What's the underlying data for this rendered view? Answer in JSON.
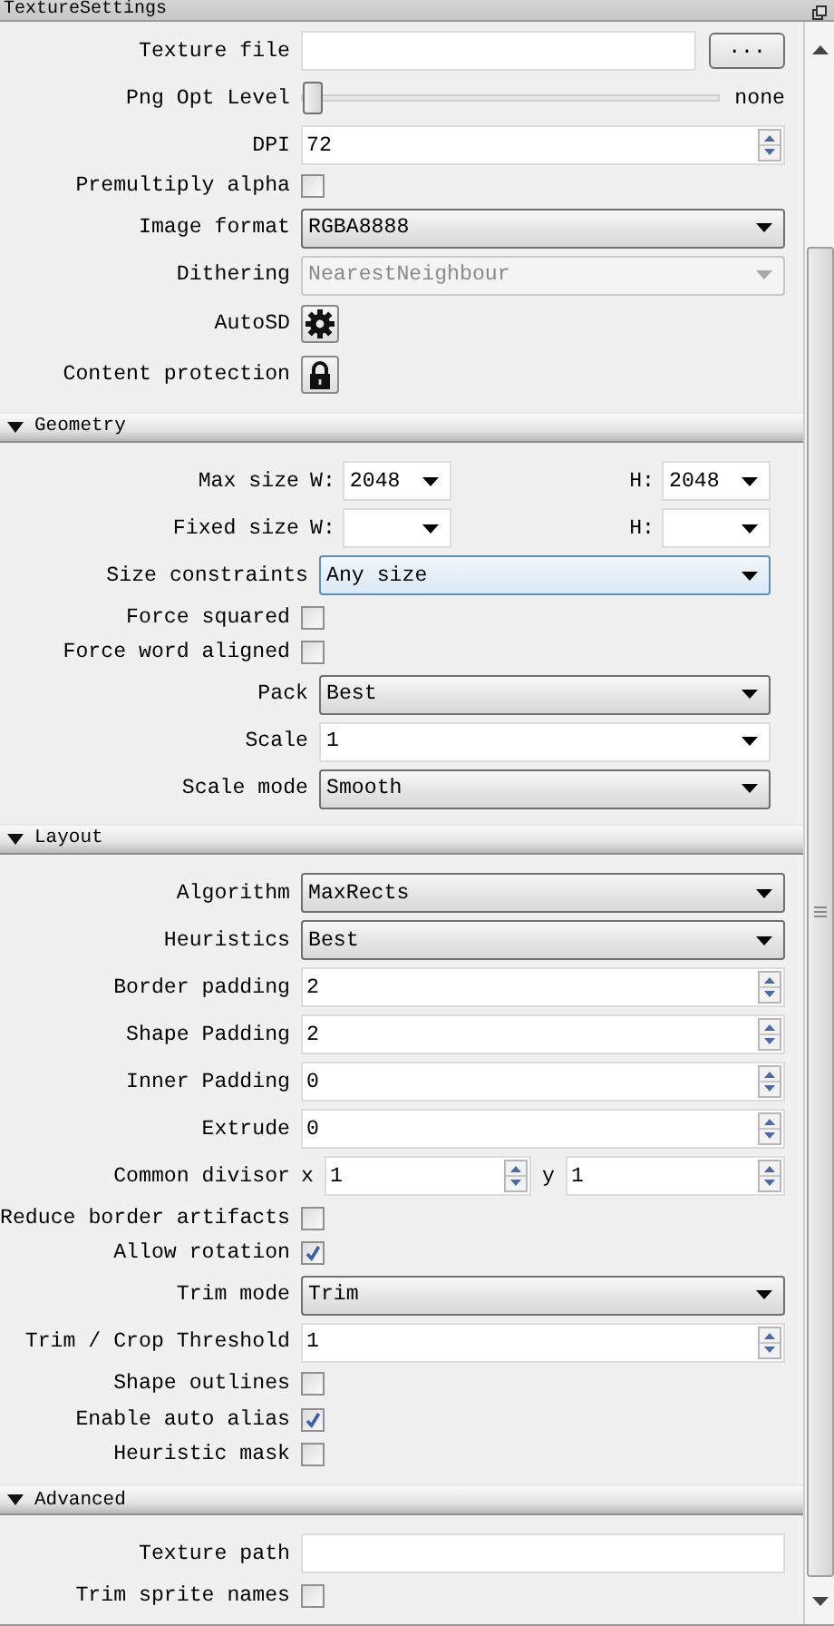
{
  "window": {
    "title": "TextureSettings"
  },
  "sections": [
    {
      "rows": [
        {
          "kind": "file",
          "label": "Texture file",
          "button": "..."
        },
        {
          "kind": "slider",
          "label": "Png Opt Level",
          "level": 0,
          "reading": "none"
        },
        {
          "kind": "spin",
          "label": "DPI",
          "value": "72"
        },
        {
          "kind": "check",
          "label": "Premultiply alpha",
          "checked": false
        },
        {
          "kind": "combo",
          "label": "Image format",
          "value": "RGBA8888",
          "editable": false,
          "disabled": false,
          "focused": false
        },
        {
          "kind": "combo",
          "label": "Dithering",
          "value": "NearestNeighbour",
          "editable": false,
          "disabled": true,
          "focused": false
        },
        {
          "kind": "gear",
          "label": "AutoSD"
        },
        {
          "kind": "lock",
          "label": "Content protection"
        }
      ]
    },
    {
      "title": "Geometry",
      "expanded": true,
      "rows": [
        {
          "kind": "size",
          "label": "Max size",
          "w_label": "W:",
          "w_value": "2048",
          "h_label": "H:",
          "h_value": "2048"
        },
        {
          "kind": "size",
          "label": "Fixed size",
          "w_label": "W:",
          "h_label": "H:"
        },
        {
          "kind": "combo",
          "label": "Size constraints",
          "value": "Any size",
          "editable": false,
          "disabled": false,
          "focused": true
        },
        {
          "kind": "check",
          "label": "Force squared",
          "checked": false
        },
        {
          "kind": "check",
          "label": "Force word aligned",
          "checked": false
        },
        {
          "kind": "combo",
          "label": "Pack",
          "value": "Best",
          "editable": false,
          "disabled": false,
          "focused": false
        },
        {
          "kind": "combo",
          "label": "Scale",
          "value": "1",
          "editable": true,
          "disabled": false,
          "focused": false
        },
        {
          "kind": "combo",
          "label": "Scale mode",
          "value": "Smooth",
          "editable": false,
          "disabled": false,
          "focused": false
        }
      ]
    },
    {
      "title": "Layout",
      "expanded": true,
      "rows": [
        {
          "kind": "combo",
          "label": "Algorithm",
          "value": "MaxRects",
          "editable": false,
          "disabled": false,
          "focused": false
        },
        {
          "kind": "combo",
          "label": "Heuristics",
          "value": "Best",
          "editable": false,
          "disabled": false,
          "focused": false
        },
        {
          "kind": "spin",
          "label": "Border padding",
          "value": "2"
        },
        {
          "kind": "spin",
          "label": "Shape Padding",
          "value": "2"
        },
        {
          "kind": "spin",
          "label": "Inner Padding",
          "value": "0"
        },
        {
          "kind": "spin",
          "label": "Extrude",
          "value": "0"
        },
        {
          "kind": "divisor",
          "label": "Common divisor",
          "x_label": "x",
          "x_value": "1",
          "y_label": "y",
          "y_value": "1"
        },
        {
          "kind": "check",
          "label": "Reduce border artifacts",
          "checked": false
        },
        {
          "kind": "check",
          "label": "Allow rotation",
          "checked": true
        },
        {
          "kind": "combo",
          "label": "Trim mode",
          "value": "Trim",
          "editable": false,
          "disabled": false,
          "focused": false
        },
        {
          "kind": "spin",
          "label": "Trim / Crop Threshold",
          "value": "1"
        },
        {
          "kind": "check",
          "label": "Shape outlines",
          "checked": false
        },
        {
          "kind": "check",
          "label": "Enable auto alias",
          "checked": true
        },
        {
          "kind": "check",
          "label": "Heuristic mask",
          "checked": false
        }
      ]
    },
    {
      "title": "Advanced",
      "expanded": true,
      "rows": [
        {
          "kind": "file",
          "label": "Texture path"
        },
        {
          "kind": "check",
          "label": "Trim sprite names",
          "checked": false
        }
      ]
    }
  ]
}
